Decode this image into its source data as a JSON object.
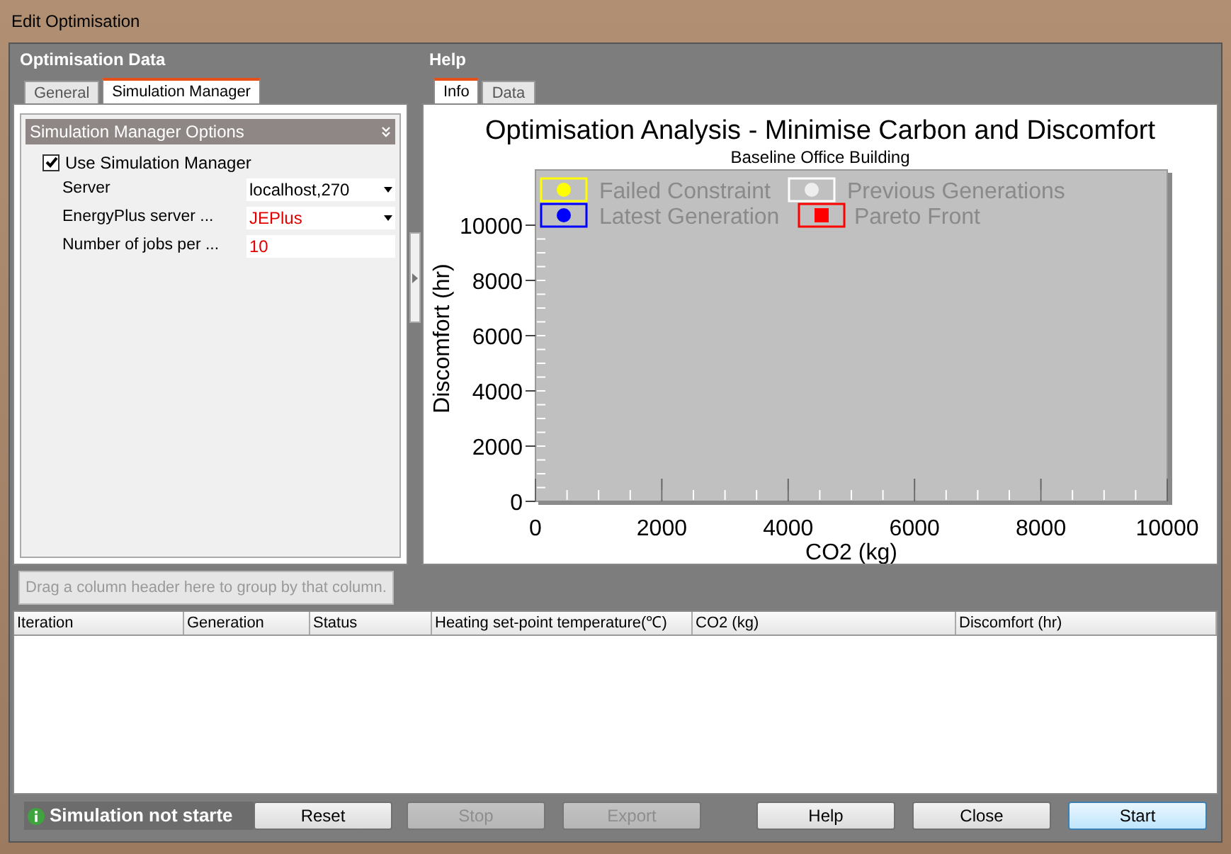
{
  "window": {
    "title": "Edit Optimisation"
  },
  "left_panel": {
    "title": "Optimisation Data",
    "tabs": [
      {
        "label": "General",
        "selected": false
      },
      {
        "label": "Simulation Manager",
        "selected": true
      }
    ],
    "section": {
      "title": "Simulation Manager Options",
      "expanded": true
    },
    "use_simulation_manager": {
      "label": "Use Simulation Manager",
      "checked": true
    },
    "properties": [
      {
        "label": "Server",
        "value": "localhost,270",
        "kind": "dropdown",
        "highlight": false
      },
      {
        "label": "EnergyPlus server ...",
        "value": "JEPlus",
        "kind": "dropdown",
        "highlight": true
      },
      {
        "label": "Number of jobs per ...",
        "value": "10",
        "kind": "text",
        "highlight": true
      }
    ]
  },
  "right_panel": {
    "title": "Help",
    "tabs": [
      {
        "label": "Info",
        "selected": true
      },
      {
        "label": "Data",
        "selected": false
      }
    ],
    "chart": {
      "subtitle": "Baseline Office Building",
      "chart_data": {
        "type": "scatter",
        "title": "Optimisation Analysis - Minimise Carbon and Discomfort",
        "xlabel": "CO2 (kg)",
        "ylabel": "Discomfort (hr)",
        "categories": [
          "0",
          "2000",
          "4000",
          "6000",
          "8000",
          "10000"
        ],
        "ylim": [
          0,
          12000
        ],
        "yticks": [
          0,
          2000,
          4000,
          6000,
          8000,
          10000
        ],
        "series": [
          {
            "name": "Failed Constraint",
            "color": "#ffff00",
            "marker": "circle",
            "values": [
              null,
              null,
              null,
              null,
              null,
              null
            ]
          },
          {
            "name": "Previous Generations",
            "color": "#eeeeee",
            "marker": "circle",
            "values": [
              null,
              null,
              null,
              null,
              null,
              null
            ]
          },
          {
            "name": "Latest Generation",
            "color": "#0000ff",
            "marker": "circle",
            "values": [
              null,
              null,
              null,
              null,
              null,
              null
            ]
          },
          {
            "name": "Pareto Front",
            "color": "#ff0000",
            "marker": "square",
            "values": [
              null,
              null,
              null,
              null,
              null,
              null
            ]
          }
        ]
      }
    }
  },
  "grid": {
    "group_hint": "Drag a column header here to group by that column.",
    "columns": [
      "Iteration",
      "Generation",
      "Status",
      "Heating set-point temperature(℃)",
      "CO2 (kg)",
      "Discomfort (hr)"
    ]
  },
  "status": {
    "text": "Simulation not starte"
  },
  "buttons": [
    {
      "label": "Reset",
      "disabled": false,
      "default": false
    },
    {
      "label": "Stop",
      "disabled": true,
      "default": false
    },
    {
      "label": "Export",
      "disabled": true,
      "default": false
    },
    {
      "label": "Help",
      "disabled": false,
      "default": false
    },
    {
      "label": "Close",
      "disabled": false,
      "default": false
    },
    {
      "label": "Start",
      "disabled": false,
      "default": true
    }
  ]
}
